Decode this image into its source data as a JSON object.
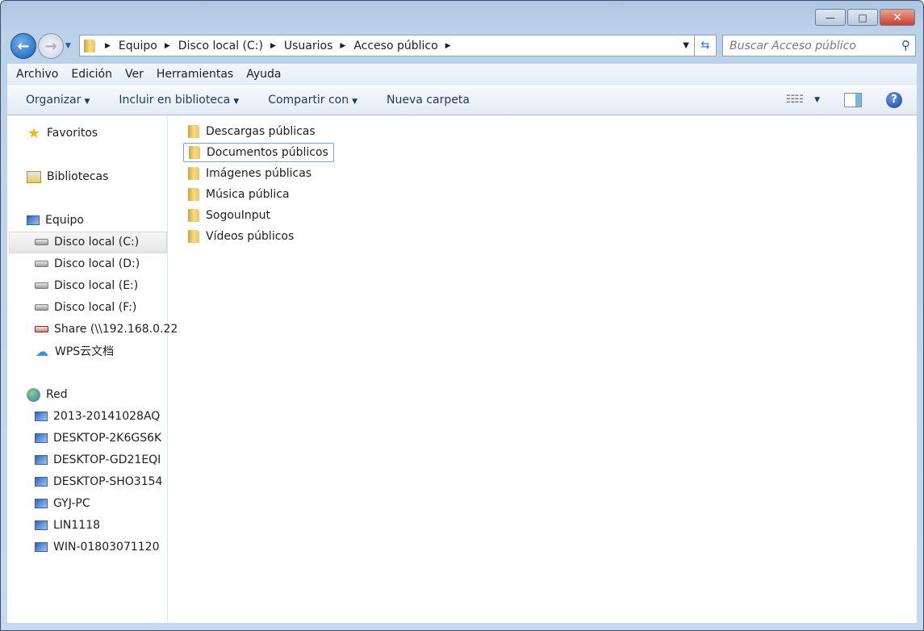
{
  "window": {
    "minimize": "—",
    "maximize": "□",
    "close": "✕"
  },
  "address": {
    "crumbs": [
      "Equipo",
      "Disco local (C:)",
      "Usuarios",
      "Acceso público"
    ]
  },
  "search": {
    "placeholder": "Buscar Acceso público"
  },
  "menu": [
    "Archivo",
    "Edición",
    "Ver",
    "Herramientas",
    "Ayuda"
  ],
  "toolbar": {
    "organize": "Organizar",
    "include": "Incluir en biblioteca",
    "share": "Compartir con",
    "new_folder": "Nueva carpeta",
    "help": "?"
  },
  "sidebar": {
    "favorites": "Favoritos",
    "libraries": "Bibliotecas",
    "computer": "Equipo",
    "drives": [
      {
        "label": "Disco local (C:)",
        "icon": "system-drive-icon",
        "selected": true
      },
      {
        "label": "Disco local (D:)",
        "icon": "drive-icon"
      },
      {
        "label": "Disco local (E:)",
        "icon": "drive-icon"
      },
      {
        "label": "Disco local (F:)",
        "icon": "drive-icon"
      },
      {
        "label": "Share (\\\\192.168.0.22",
        "icon": "disconnected-share-icon"
      },
      {
        "label": "WPS云文档",
        "icon": "cloud-icon"
      }
    ],
    "network": "Red",
    "computers": [
      "2013-20141028AQ",
      "DESKTOP-2K6GS6K",
      "DESKTOP-GD21EQI",
      "DESKTOP-SHO3154",
      "GYJ-PC",
      "LIN1118",
      "WIN-01803071120"
    ]
  },
  "files": [
    {
      "name": "Descargas públicas"
    },
    {
      "name": "Documentos públicos",
      "focused": true
    },
    {
      "name": "Imágenes públicas"
    },
    {
      "name": "Música pública"
    },
    {
      "name": "SogouInput"
    },
    {
      "name": "Vídeos públicos"
    }
  ]
}
